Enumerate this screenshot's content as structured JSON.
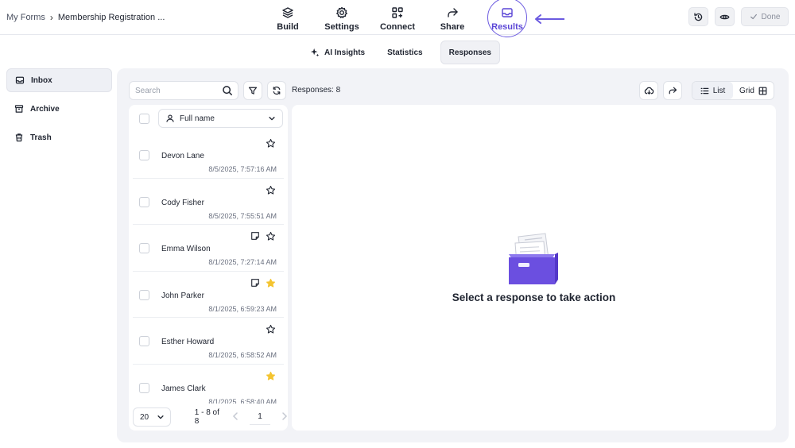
{
  "breadcrumb": {
    "root": "My Forms",
    "separator": "›",
    "current": "Membership Registration ..."
  },
  "nav": [
    {
      "id": "build",
      "label": "Build",
      "icon": "stack-icon"
    },
    {
      "id": "settings",
      "label": "Settings",
      "icon": "gear-icon"
    },
    {
      "id": "connect",
      "label": "Connect",
      "icon": "grid-plus-icon"
    },
    {
      "id": "share",
      "label": "Share",
      "icon": "share-arrow-icon"
    },
    {
      "id": "results",
      "label": "Results",
      "icon": "inbox-icon",
      "active": true
    }
  ],
  "topright": {
    "history_icon": "history-icon",
    "preview_icon": "eye-icon",
    "done_label": "Done"
  },
  "subtabs": [
    {
      "label": "AI Insights",
      "icon": "sparkle-icon"
    },
    {
      "label": "Statistics"
    },
    {
      "label": "Responses",
      "active": true
    }
  ],
  "sidebar": [
    {
      "label": "Inbox",
      "icon": "inbox-icon",
      "active": true
    },
    {
      "label": "Archive",
      "icon": "archive-icon"
    },
    {
      "label": "Trash",
      "icon": "trash-icon"
    }
  ],
  "toolbar": {
    "search_placeholder": "Search",
    "responses_count": "Responses: 8",
    "view_list": "List",
    "view_grid": "Grid"
  },
  "list": {
    "field_select": "Full name",
    "rows": [
      {
        "name": "Devon Lane",
        "timestamp": "8/5/2025, 7:57:16 AM",
        "starred": false,
        "note": false
      },
      {
        "name": "Cody Fisher",
        "timestamp": "8/5/2025, 7:55:51 AM",
        "starred": false,
        "note": false
      },
      {
        "name": "Emma Wilson",
        "timestamp": "8/1/2025, 7:27:14 AM",
        "starred": false,
        "note": true
      },
      {
        "name": "John Parker",
        "timestamp": "8/1/2025, 6:59:23 AM",
        "starred": true,
        "note": true
      },
      {
        "name": "Esther Howard",
        "timestamp": "8/1/2025, 6:58:52 AM",
        "starred": false,
        "note": false
      },
      {
        "name": "James Clark",
        "timestamp": "8/1/2025, 6:58:40 AM",
        "starred": true,
        "note": false
      }
    ],
    "page_size": "20",
    "range": "1 - 8 of 8",
    "page": "1"
  },
  "detail": {
    "empty_message": "Select a response to take action"
  },
  "colors": {
    "accent": "#5a45d6",
    "star_filled": "#f4c430",
    "panel_bg": "#f2f3f7",
    "illustration": "#6b4fe0"
  }
}
